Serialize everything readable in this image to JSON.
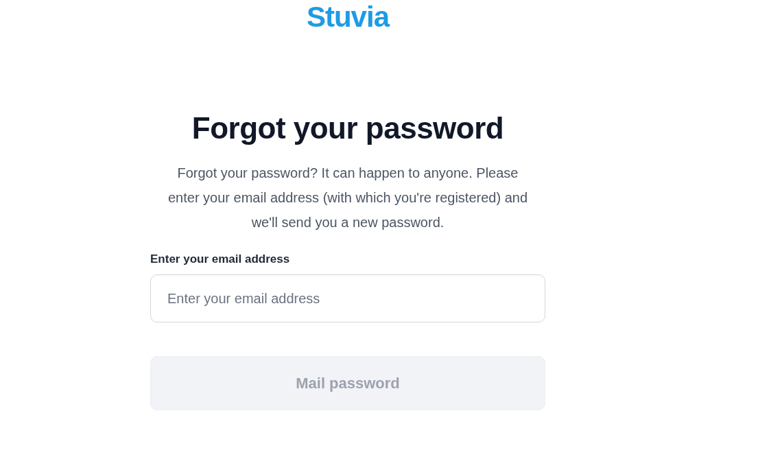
{
  "logo": {
    "text": "Stuvia"
  },
  "heading": "Forgot your password",
  "intro": "Forgot your password? It can happen to anyone. Please enter your email address (with which you're registered) and we'll send you a new password.",
  "email_field": {
    "label": "Enter your email address",
    "placeholder": "Enter your email address"
  },
  "submit_button": {
    "label": "Mail password",
    "disabled": true
  }
}
